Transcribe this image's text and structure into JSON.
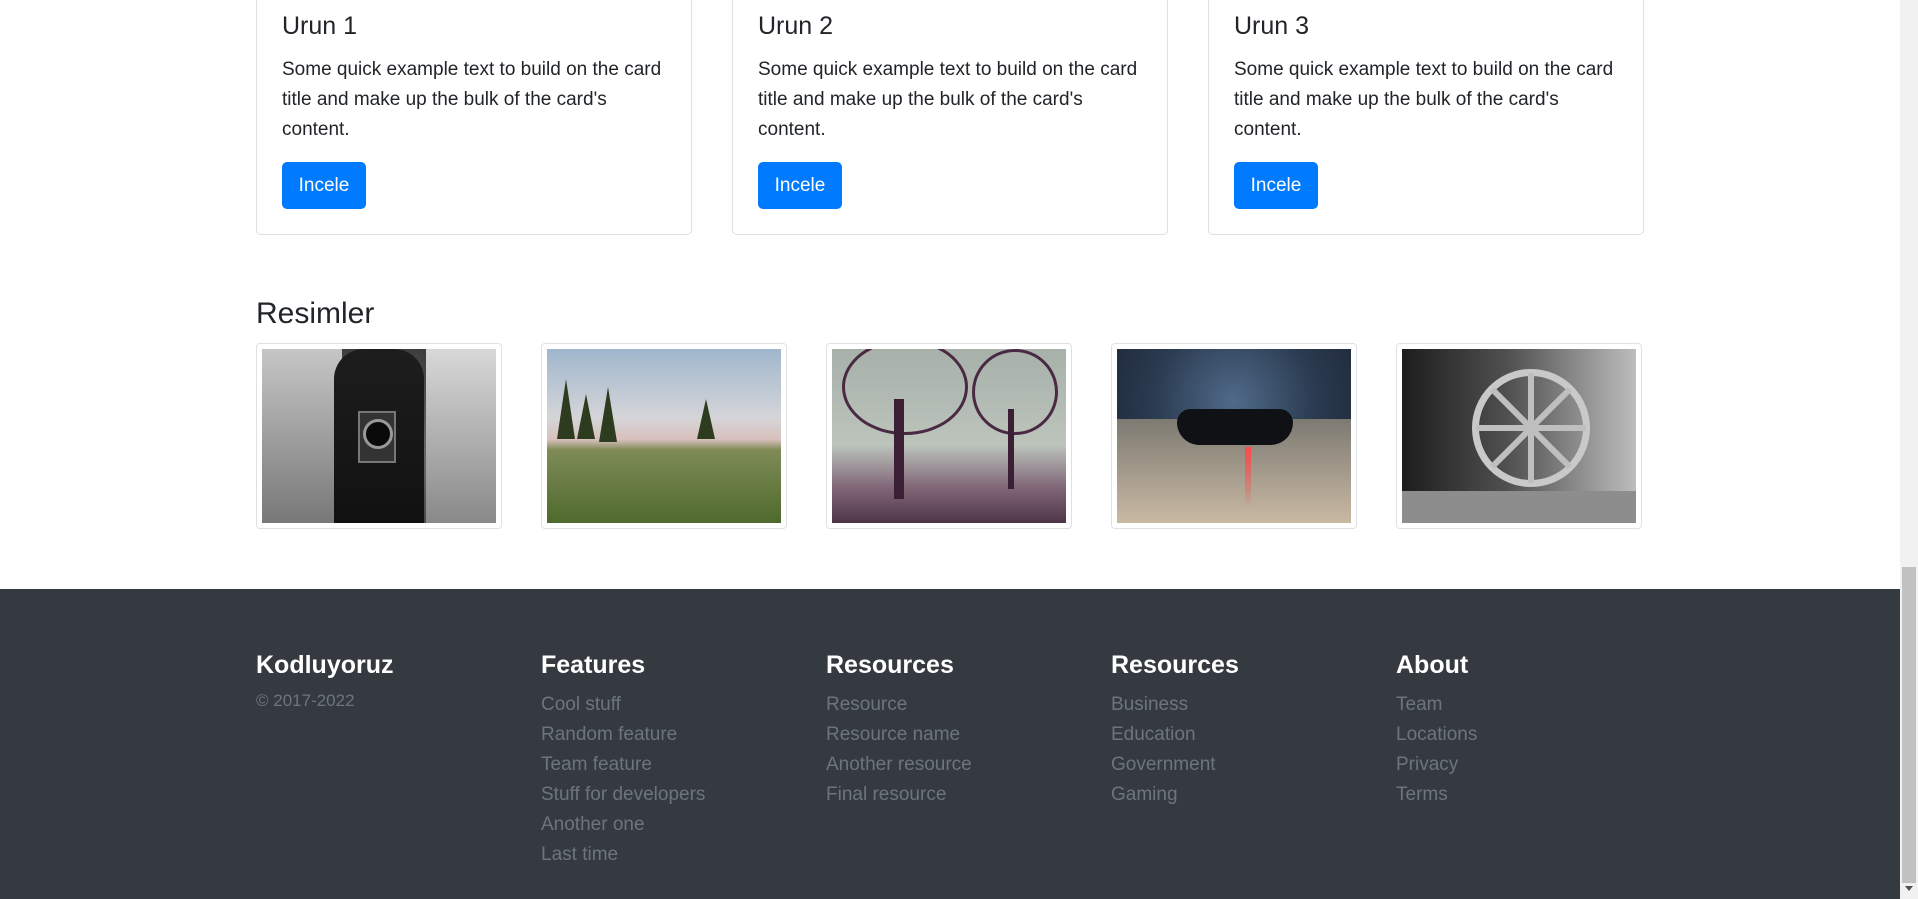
{
  "cards": [
    {
      "title": "Urun 1",
      "text": "Some quick example text to build on the card title and make up the bulk of the card's content.",
      "button_label": "Incele"
    },
    {
      "title": "Urun 2",
      "text": "Some quick example text to build on the card title and make up the bulk of the card's content.",
      "button_label": "Incele"
    },
    {
      "title": "Urun 3",
      "text": "Some quick example text to build on the card title and make up the bulk of the card's content.",
      "button_label": "Incele"
    }
  ],
  "gallery": {
    "title": "Resimler",
    "images": [
      "camera-photo",
      "meadow-photo",
      "foggy-trees-photo",
      "game-controller-photo",
      "wagon-wheel-photo"
    ]
  },
  "footer": {
    "brand": "Kodluyoruz",
    "copyright": "© 2017-2022",
    "columns": [
      {
        "title": "Features",
        "items": [
          "Cool stuff",
          "Random feature",
          "Team feature",
          "Stuff for developers",
          "Another one",
          "Last time"
        ]
      },
      {
        "title": "Resources",
        "items": [
          "Resource",
          "Resource name",
          "Another resource",
          "Final resource"
        ]
      },
      {
        "title": "Resources",
        "items": [
          "Business",
          "Education",
          "Government",
          "Gaming"
        ]
      },
      {
        "title": "About",
        "items": [
          "Team",
          "Locations",
          "Privacy",
          "Terms"
        ]
      }
    ]
  },
  "colors": {
    "primary": "#007bff",
    "footer_bg": "#343a40",
    "muted": "#6c757d"
  }
}
